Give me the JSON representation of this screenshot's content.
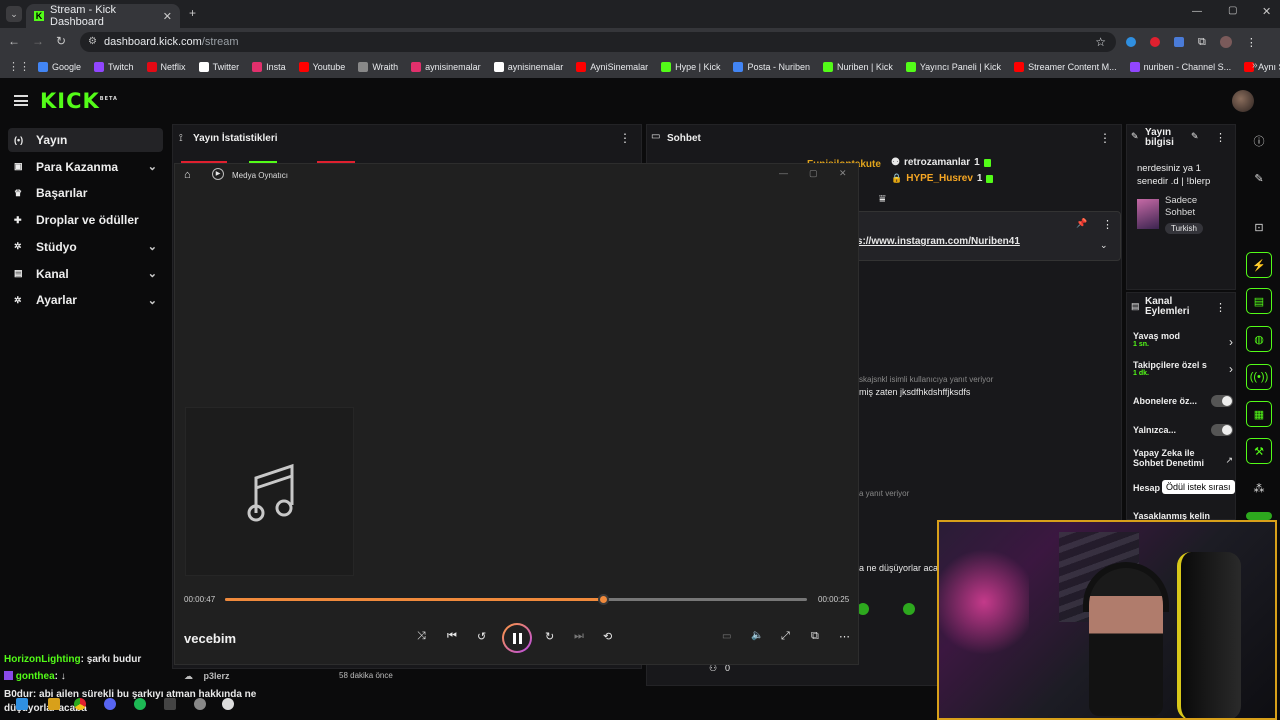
{
  "browser": {
    "tab_title": "Stream - Kick Dashboard",
    "url_host": "dashboard.kick.com",
    "url_path": "/stream",
    "bookmarks": [
      {
        "label": "Google",
        "color": "#4285f4"
      },
      {
        "label": "Twitch",
        "color": "#9146ff"
      },
      {
        "label": "Netflix",
        "color": "#e50914"
      },
      {
        "label": "Twitter",
        "color": "#ffffff"
      },
      {
        "label": "Insta",
        "color": "#e1306c"
      },
      {
        "label": "Youtube",
        "color": "#ff0000"
      },
      {
        "label": "Wraith",
        "color": "#888888"
      },
      {
        "label": "aynisinemalar",
        "color": "#e1306c"
      },
      {
        "label": "aynisinemalar",
        "color": "#ffffff"
      },
      {
        "label": "AyniSinemalar",
        "color": "#ff0000"
      },
      {
        "label": "Hype | Kick",
        "color": "#53fc18"
      },
      {
        "label": "Posta - Nuriben",
        "color": "#4285f4"
      },
      {
        "label": "Nuriben | Kick",
        "color": "#53fc18"
      },
      {
        "label": "Yayıncı Paneli | Kick",
        "color": "#53fc18"
      },
      {
        "label": "Streamer Content M...",
        "color": "#ff0000"
      },
      {
        "label": "nuriben - Channel S...",
        "color": "#9146ff"
      },
      {
        "label": "Aynı Sinemalar - Ça...",
        "color": "#ff0000"
      }
    ]
  },
  "sidebar": {
    "items": [
      {
        "label": "Yayın",
        "icon": "broadcast-icon",
        "active": true
      },
      {
        "label": "Para Kazanma",
        "icon": "wallet-icon",
        "chevron": true
      },
      {
        "label": "Başarılar",
        "icon": "trophy-icon"
      },
      {
        "label": "Droplar ve ödüller",
        "icon": "gift-icon"
      },
      {
        "label": "Stüdyo",
        "icon": "gear-icon",
        "chevron": true
      },
      {
        "label": "Kanal",
        "icon": "channel-icon",
        "chevron": true
      },
      {
        "label": "Ayarlar",
        "icon": "gear-icon",
        "chevron": true
      }
    ]
  },
  "stats_panel": {
    "title": "Yayın İstatistikleri"
  },
  "chat_panel": {
    "title": "Sohbet",
    "top_users": [
      {
        "name": "Funisilontakute",
        "color": "#e1a41c"
      },
      {
        "name": "retrozamanlar",
        "count": "1",
        "color": "#dddddd"
      },
      {
        "name": "HYPE_Husrev",
        "count": "1",
        "color": "#f5a623"
      }
    ],
    "pinned_link": "https://www.instagram.com/Nuriben41",
    "reply_text": "skajsnkl isimli kullanıcıya yanıt veriyor",
    "msg_text": "miş zaten jksdfhkdshffjksdfs",
    "reply_text2": "a yanıt veriyor",
    "msg_text2": "a ne düşüyorlar aca",
    "footer_count": "0"
  },
  "stream_info": {
    "title": "Yayın bilgisi",
    "stream_title": "nerdesiniz ya 1 senedir .d | !blerp",
    "category": "Sadece Sohbet",
    "tag": "Turkish"
  },
  "channel_actions": {
    "title": "Kanal Eylemleri",
    "items": [
      {
        "label": "Yavaş mod",
        "sub": "1 sn."
      },
      {
        "label": "Takipçilere özel s",
        "sub": "1 dk."
      },
      {
        "label": "Abonelere öz..."
      },
      {
        "label": "Yalnızca..."
      },
      {
        "label": "Yapay Zeka ile Sohbet Denetimi"
      },
      {
        "label": "Hesap"
      },
      {
        "label": "Yasaklanmış kelin"
      }
    ],
    "tooltip": "Ödül istek sırası"
  },
  "media_player": {
    "app_title": "Medya Oynatıcı",
    "elapsed": "00:00:47",
    "remaining": "00:00:25",
    "progress": 0.65,
    "track_title": "vecebim"
  },
  "chat_overlay": {
    "messages": [
      {
        "user": "HorizonLighting",
        "text": ": şarkı budur",
        "color": "#53fc18"
      },
      {
        "user": "gonthea",
        "text": ": ↓",
        "color": "#53fc18"
      },
      {
        "user": "B0dur",
        "text": ": abi ailen sürekli bu şarkıyı atman hakkında ne düşüyorlar acaba",
        "color": "#ffffff"
      }
    ]
  },
  "recent": {
    "user": "p3lerz",
    "time": "58 dakika önce"
  }
}
